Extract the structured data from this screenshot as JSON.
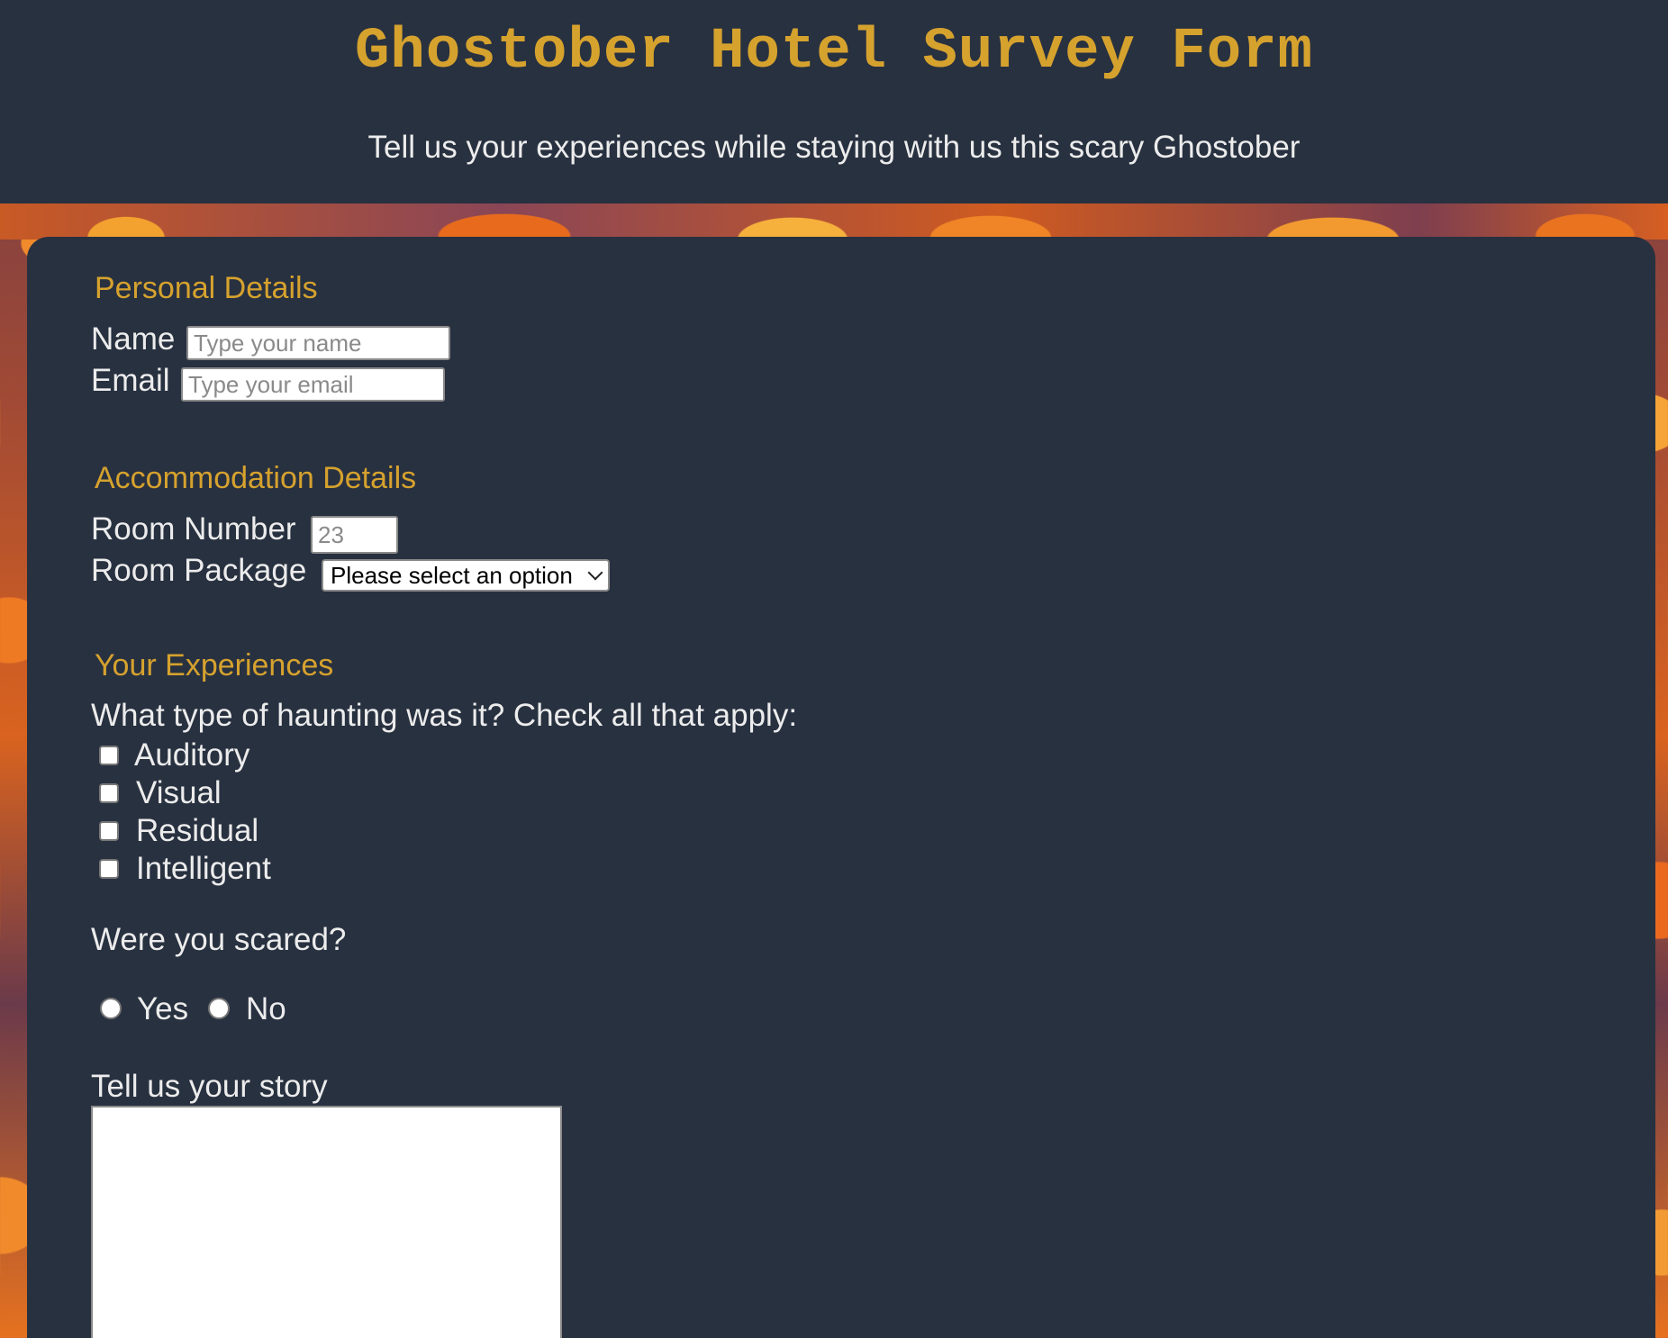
{
  "header": {
    "title": "Ghostober Hotel Survey Form",
    "subtitle": "Tell us your experiences while staying with us this scary Ghostober"
  },
  "personal": {
    "heading": "Personal Details",
    "name_label": "Name",
    "name_placeholder": "Type your name",
    "email_label": "Email",
    "email_placeholder": "Type your email"
  },
  "accommodation": {
    "heading": "Accommodation Details",
    "room_number_label": "Room Number",
    "room_number_placeholder": "23",
    "room_package_label": "Room Package",
    "room_package_selected": "Please select an option"
  },
  "experiences": {
    "heading": "Your Experiences",
    "haunting_question": "What type of haunting was it? Check all that apply:",
    "haunting_options": [
      "Auditory",
      "Visual",
      "Residual",
      "Intelligent"
    ],
    "scared_question": "Were you scared?",
    "scared_options": [
      "Yes",
      "No"
    ],
    "story_label": "Tell us your story",
    "story_value": ""
  },
  "colors": {
    "header_bg": "#283140",
    "accent": "#d6a22e",
    "text": "#ececec"
  }
}
